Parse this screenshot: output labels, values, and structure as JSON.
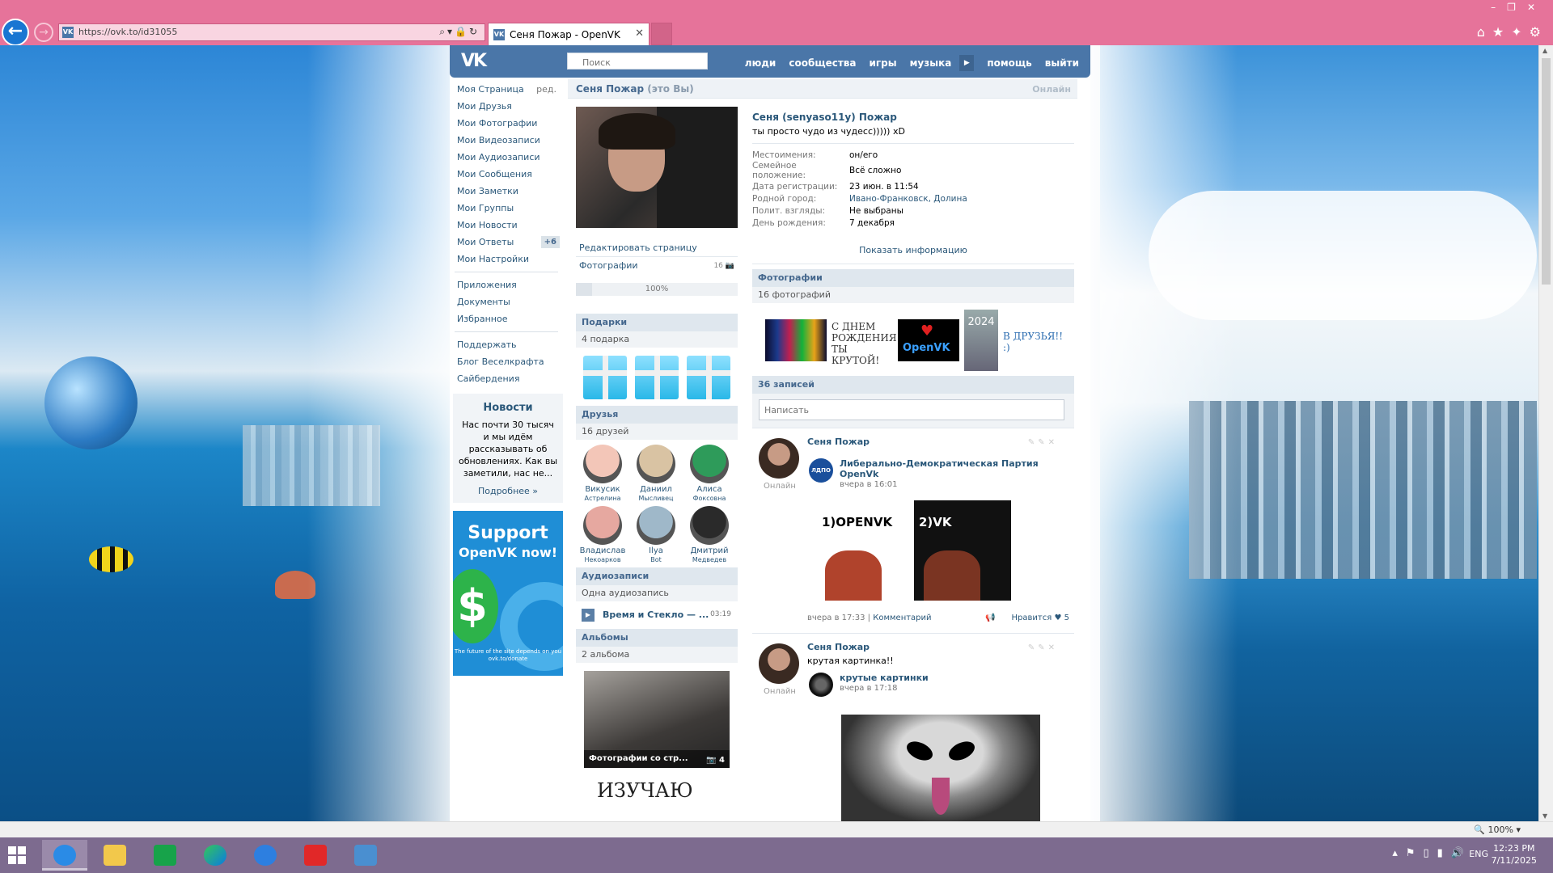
{
  "browser": {
    "url": "https://ovk.to/id31055",
    "tab_title": "Сеня Пожар - OpenVK",
    "favicon_text": "VK",
    "zoom": "100%"
  },
  "header": {
    "logo": "VK",
    "search_placeholder": "Поиск",
    "nav": [
      "люди",
      "сообщества",
      "игры",
      "музыка",
      "помощь",
      "выйти"
    ]
  },
  "sidebar": {
    "items": [
      {
        "label": "Моя Страница",
        "extra": "ред."
      },
      {
        "label": "Мои Друзья"
      },
      {
        "label": "Мои Фотографии"
      },
      {
        "label": "Мои Видеозаписи"
      },
      {
        "label": "Мои Аудиозаписи"
      },
      {
        "label": "Мои Сообщения"
      },
      {
        "label": "Мои Заметки"
      },
      {
        "label": "Мои Группы"
      },
      {
        "label": "Мои Новости"
      },
      {
        "label": "Мои Ответы",
        "badge": "+6"
      },
      {
        "label": "Мои Настройки"
      }
    ],
    "extra_items": [
      "Приложения",
      "Документы",
      "Избранное"
    ],
    "link_items": [
      "Поддержать",
      "Блог Веселкрафта",
      "Сайбердения"
    ],
    "news": {
      "title": "Новости",
      "text": "Нас почти 30 тысяч и мы идём рассказывать об обновлениях. Как вы заметили, нас не...",
      "more": "Подробнее »"
    },
    "support": {
      "title": "Support",
      "subtitle": "OpenVK now!",
      "symbol": "$",
      "footer": "The future of the site depends on you ovk.to/donate"
    }
  },
  "profile_bar": {
    "name": "Сеня Пожар",
    "you": "(это Вы)",
    "online": "Онлайн"
  },
  "left_col": {
    "edit_page": "Редактировать страницу",
    "photos_link": "Фотографии",
    "photos_count": "16",
    "photos_icon": "camera-icon",
    "progress": "100%",
    "gifts": {
      "title": "Подарки",
      "count": "4 подарка"
    },
    "friends": {
      "title": "Друзья",
      "count": "16 друзей",
      "list": [
        {
          "name": "Викусик",
          "surname": "Астрелина",
          "color": "#f3c6b8"
        },
        {
          "name": "Даниил",
          "surname": "Мысливец",
          "color": "#d9c3a3"
        },
        {
          "name": "Алиса",
          "surname": "Фоксовна",
          "color": "#2e9b5a"
        },
        {
          "name": "Владислав",
          "surname": "Некоарков",
          "color": "#e6a8a0"
        },
        {
          "name": "Ilya",
          "surname": "Bot",
          "color": "#9fb8c9"
        },
        {
          "name": "Дмитрий",
          "surname": "Медведев",
          "color": "#2a2a2a"
        }
      ]
    },
    "audio": {
      "title": "Аудиозаписи",
      "count": "Одна аудиозапись",
      "track": "Время и Стекло — ...",
      "time": "03:19"
    },
    "albums": {
      "title": "Альбомы",
      "count": "2 альбома",
      "album_caption": "Фотографии со стр...",
      "album_count": "4",
      "album2_text": "ИЗУЧАЮ"
    }
  },
  "right_col": {
    "full_name": "Сеня (senyaso11y) Пожар",
    "status": "ты просто чудо из чудесс))))) xD",
    "info": [
      {
        "label": "Местоимения:",
        "value": "он/его"
      },
      {
        "label": "Семейное положение:",
        "value": "Всё сложно"
      },
      {
        "label": "Дата регистрации:",
        "value": "23 июн. в 11:54"
      },
      {
        "label": "Родной город:",
        "value": "Ивано-Франковск, Долина",
        "link": true
      },
      {
        "label": "Полит. взгляды:",
        "value": "Не выбраны"
      },
      {
        "label": "День рождения:",
        "value": "7 декабря"
      }
    ],
    "show_info": "Показать информацию",
    "photos": {
      "title": "Фотографии",
      "count": "16 фотографий",
      "ph2_text": "С ДНЕМ РОЖДЕНИЯ ТЫ КРУТОЙ!",
      "ph3_text": "OpenVK",
      "ph4_text": "2024",
      "ph5_text": "В ДРУЗЬЯ!! :)"
    },
    "wall": {
      "title": "36 записей",
      "write_placeholder": "Написать",
      "posts": [
        {
          "author": "Сеня Пожар",
          "status": "Онлайн",
          "repost_name": "Либерально-Демократическая Партия OpenVk",
          "repost_date": "вчера в 16:01",
          "repost_avatar_text": "ЛДПО",
          "img1_text": "1)OPENVK",
          "img2_text": "2)VK",
          "date": "вчера в 17:33",
          "comment": "Комментарий",
          "like": "Нравится",
          "likes": "5"
        },
        {
          "author": "Сеня Пожар",
          "status": "Онлайн",
          "text": "крутая картинка!!",
          "repost_name": "крутые картинки",
          "repost_date": "вчера в 17:18"
        }
      ]
    }
  },
  "taskbar": {
    "lang": "ENG",
    "time": "12:23 PM",
    "date": "7/11/2025"
  }
}
